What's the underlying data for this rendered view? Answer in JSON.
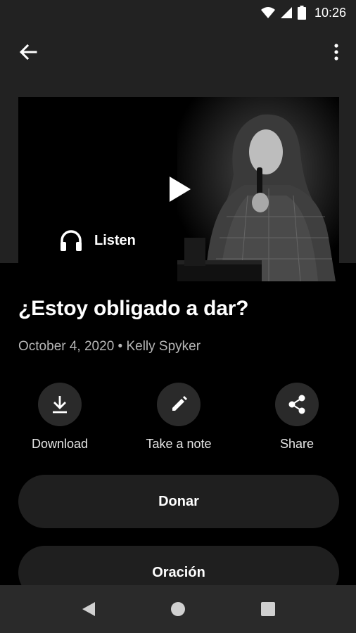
{
  "status_bar": {
    "time": "10:26"
  },
  "app_bar": {
    "back_icon": "arrow-left-icon",
    "more_icon": "more-vert-icon"
  },
  "video": {
    "play_icon": "play-icon",
    "listen_label": "Listen",
    "listen_icon": "headphones-icon"
  },
  "sermon": {
    "title": "¿Estoy obligado a dar?",
    "meta": "October 4, 2020 • Kelly Spyker"
  },
  "actions": [
    {
      "label": "Download",
      "icon": "download-icon"
    },
    {
      "label": "Take a note",
      "icon": "pencil-icon"
    },
    {
      "label": "Share",
      "icon": "share-icon"
    }
  ],
  "buttons": {
    "donar": "Donar",
    "oracion": "Oración"
  },
  "nav": {
    "back_icon": "nav-back-icon",
    "home_icon": "nav-home-icon",
    "recents_icon": "nav-recents-icon"
  }
}
